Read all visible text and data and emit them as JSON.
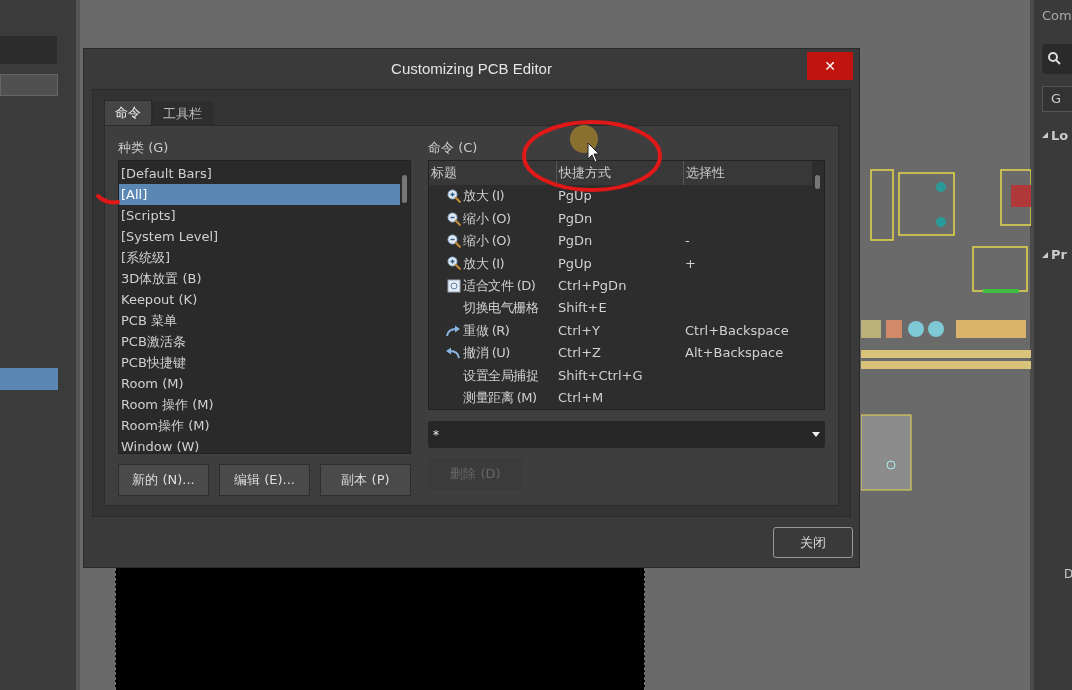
{
  "dialog": {
    "title": "Customizing PCB Editor",
    "close_glyph": "✕",
    "tabs": [
      {
        "label": "命令",
        "selected": true
      },
      {
        "label": "工具栏",
        "selected": false
      }
    ],
    "categories": {
      "label": "种类 (G)",
      "items": [
        {
          "label": "[Default Bars]",
          "selected": false
        },
        {
          "label": "[All]",
          "selected": true
        },
        {
          "label": "[Scripts]",
          "selected": false
        },
        {
          "label": "[System Level]",
          "selected": false
        },
        {
          "label": "[系统级]",
          "selected": false
        },
        {
          "label": "3D体放置 (B)",
          "selected": false
        },
        {
          "label": "Keepout (K)",
          "selected": false
        },
        {
          "label": "PCB 菜单",
          "selected": false
        },
        {
          "label": "PCB激活条",
          "selected": false
        },
        {
          "label": "PCB快捷键",
          "selected": false
        },
        {
          "label": "Room (M)",
          "selected": false
        },
        {
          "label": "Room 操作 (M)",
          "selected": false
        },
        {
          "label": "Room操作 (M)",
          "selected": false
        },
        {
          "label": "Window (W)",
          "selected": false
        }
      ]
    },
    "commands": {
      "label": "命令 (C)",
      "columns": [
        "标题",
        "快捷方式",
        "选择性"
      ],
      "rows": [
        {
          "kind": "zoomin",
          "title": "放大 (I)",
          "shortcut": "PgUp",
          "alternative": ""
        },
        {
          "kind": "zoomout",
          "title": "缩小 (O)",
          "shortcut": "PgDn",
          "alternative": ""
        },
        {
          "kind": "zoomout",
          "title": "缩小 (O)",
          "shortcut": "PgDn",
          "alternative": "-"
        },
        {
          "kind": "zoomin",
          "title": "放大 (I)",
          "shortcut": "PgUp",
          "alternative": "+"
        },
        {
          "kind": "fit",
          "title": "适合文件 (D)",
          "shortcut": "Ctrl+PgDn",
          "alternative": ""
        },
        {
          "kind": "plain",
          "title": "切换电气栅格",
          "shortcut": "Shift+E",
          "alternative": ""
        },
        {
          "kind": "redo",
          "title": "重做 (R)",
          "shortcut": "Ctrl+Y",
          "alternative": "Ctrl+Backspace"
        },
        {
          "kind": "undo",
          "title": "撤消 (U)",
          "shortcut": "Ctrl+Z",
          "alternative": "Alt+Backspace"
        },
        {
          "kind": "plain",
          "title": "设置全局捕捉",
          "shortcut": "Shift+Ctrl+G",
          "alternative": ""
        },
        {
          "kind": "plain",
          "title": "测量距离 (M)",
          "shortcut": "Ctrl+M",
          "alternative": ""
        }
      ]
    },
    "filter": {
      "value": "*"
    },
    "buttons": [
      {
        "label": "新的 (N)...",
        "disabled": false
      },
      {
        "label": "编辑 (E)...",
        "disabled": false
      },
      {
        "label": "副本 (P)",
        "disabled": false
      },
      {
        "label": "删除 (D)",
        "disabled": true
      }
    ],
    "close_button": "关闭"
  },
  "right_panel": {
    "title": "Com",
    "tab": "G",
    "sections": [
      "Lo",
      "Pr"
    ],
    "footer": "D"
  }
}
